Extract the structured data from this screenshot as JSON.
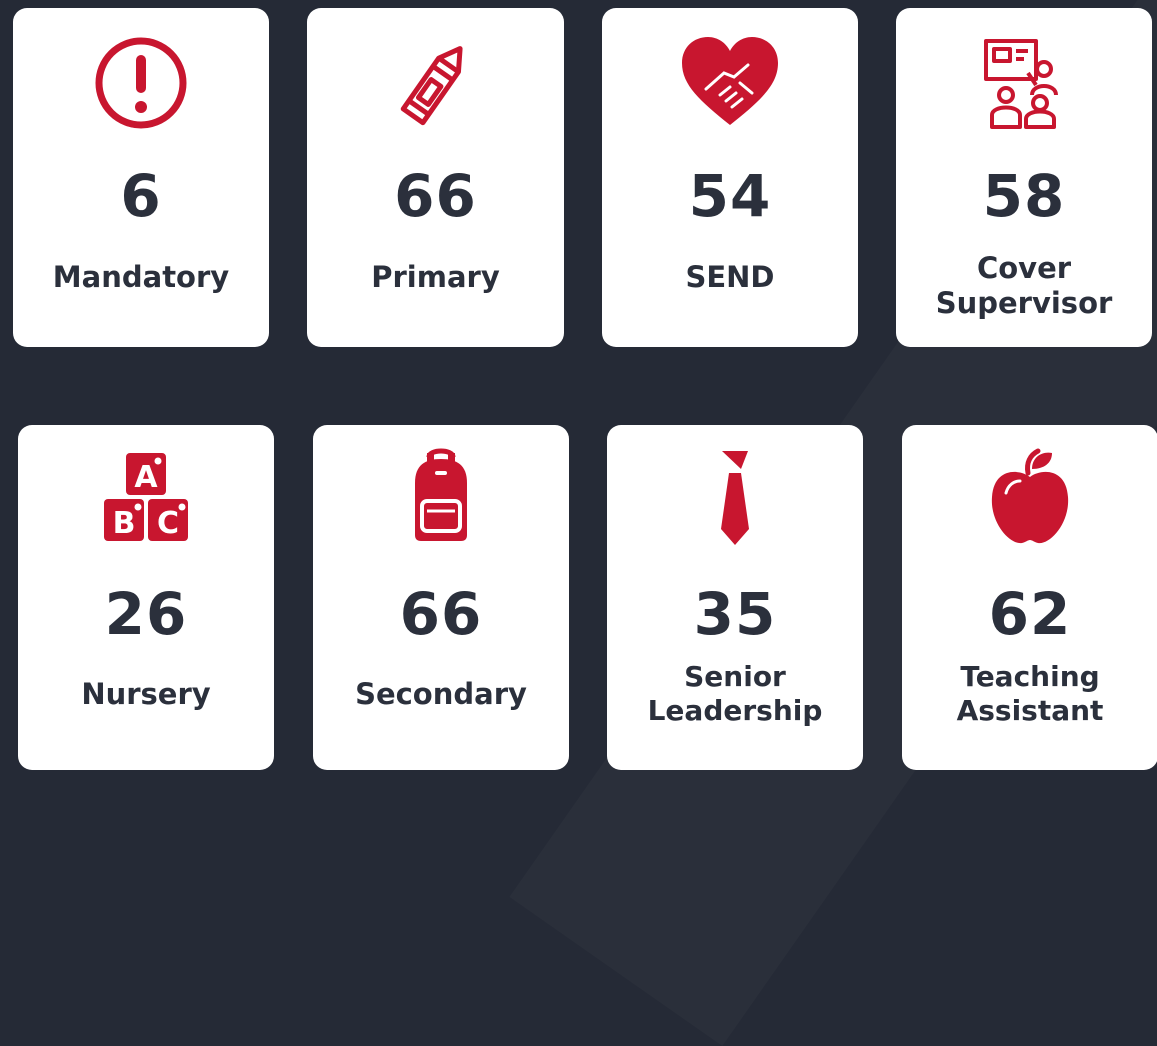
{
  "colors": {
    "background": "#252a36",
    "card": "#ffffff",
    "accent": "#c8162f",
    "text": "#2b303c"
  },
  "cards": [
    {
      "icon": "exclamation-circle-icon",
      "count": "6",
      "label": "Mandatory"
    },
    {
      "icon": "crayon-icon",
      "count": "66",
      "label": "Primary"
    },
    {
      "icon": "heart-handshake-icon",
      "count": "54",
      "label": "SEND"
    },
    {
      "icon": "classroom-teacher-icon",
      "count": "58",
      "label": "Cover\nSupervisor"
    },
    {
      "icon": "abc-blocks-icon",
      "count": "26",
      "label": "Nursery"
    },
    {
      "icon": "backpack-icon",
      "count": "66",
      "label": "Secondary"
    },
    {
      "icon": "necktie-icon",
      "count": "35",
      "label": "Senior\nLeadership"
    },
    {
      "icon": "apple-icon",
      "count": "62",
      "label": "Teaching\nAssistant"
    }
  ]
}
